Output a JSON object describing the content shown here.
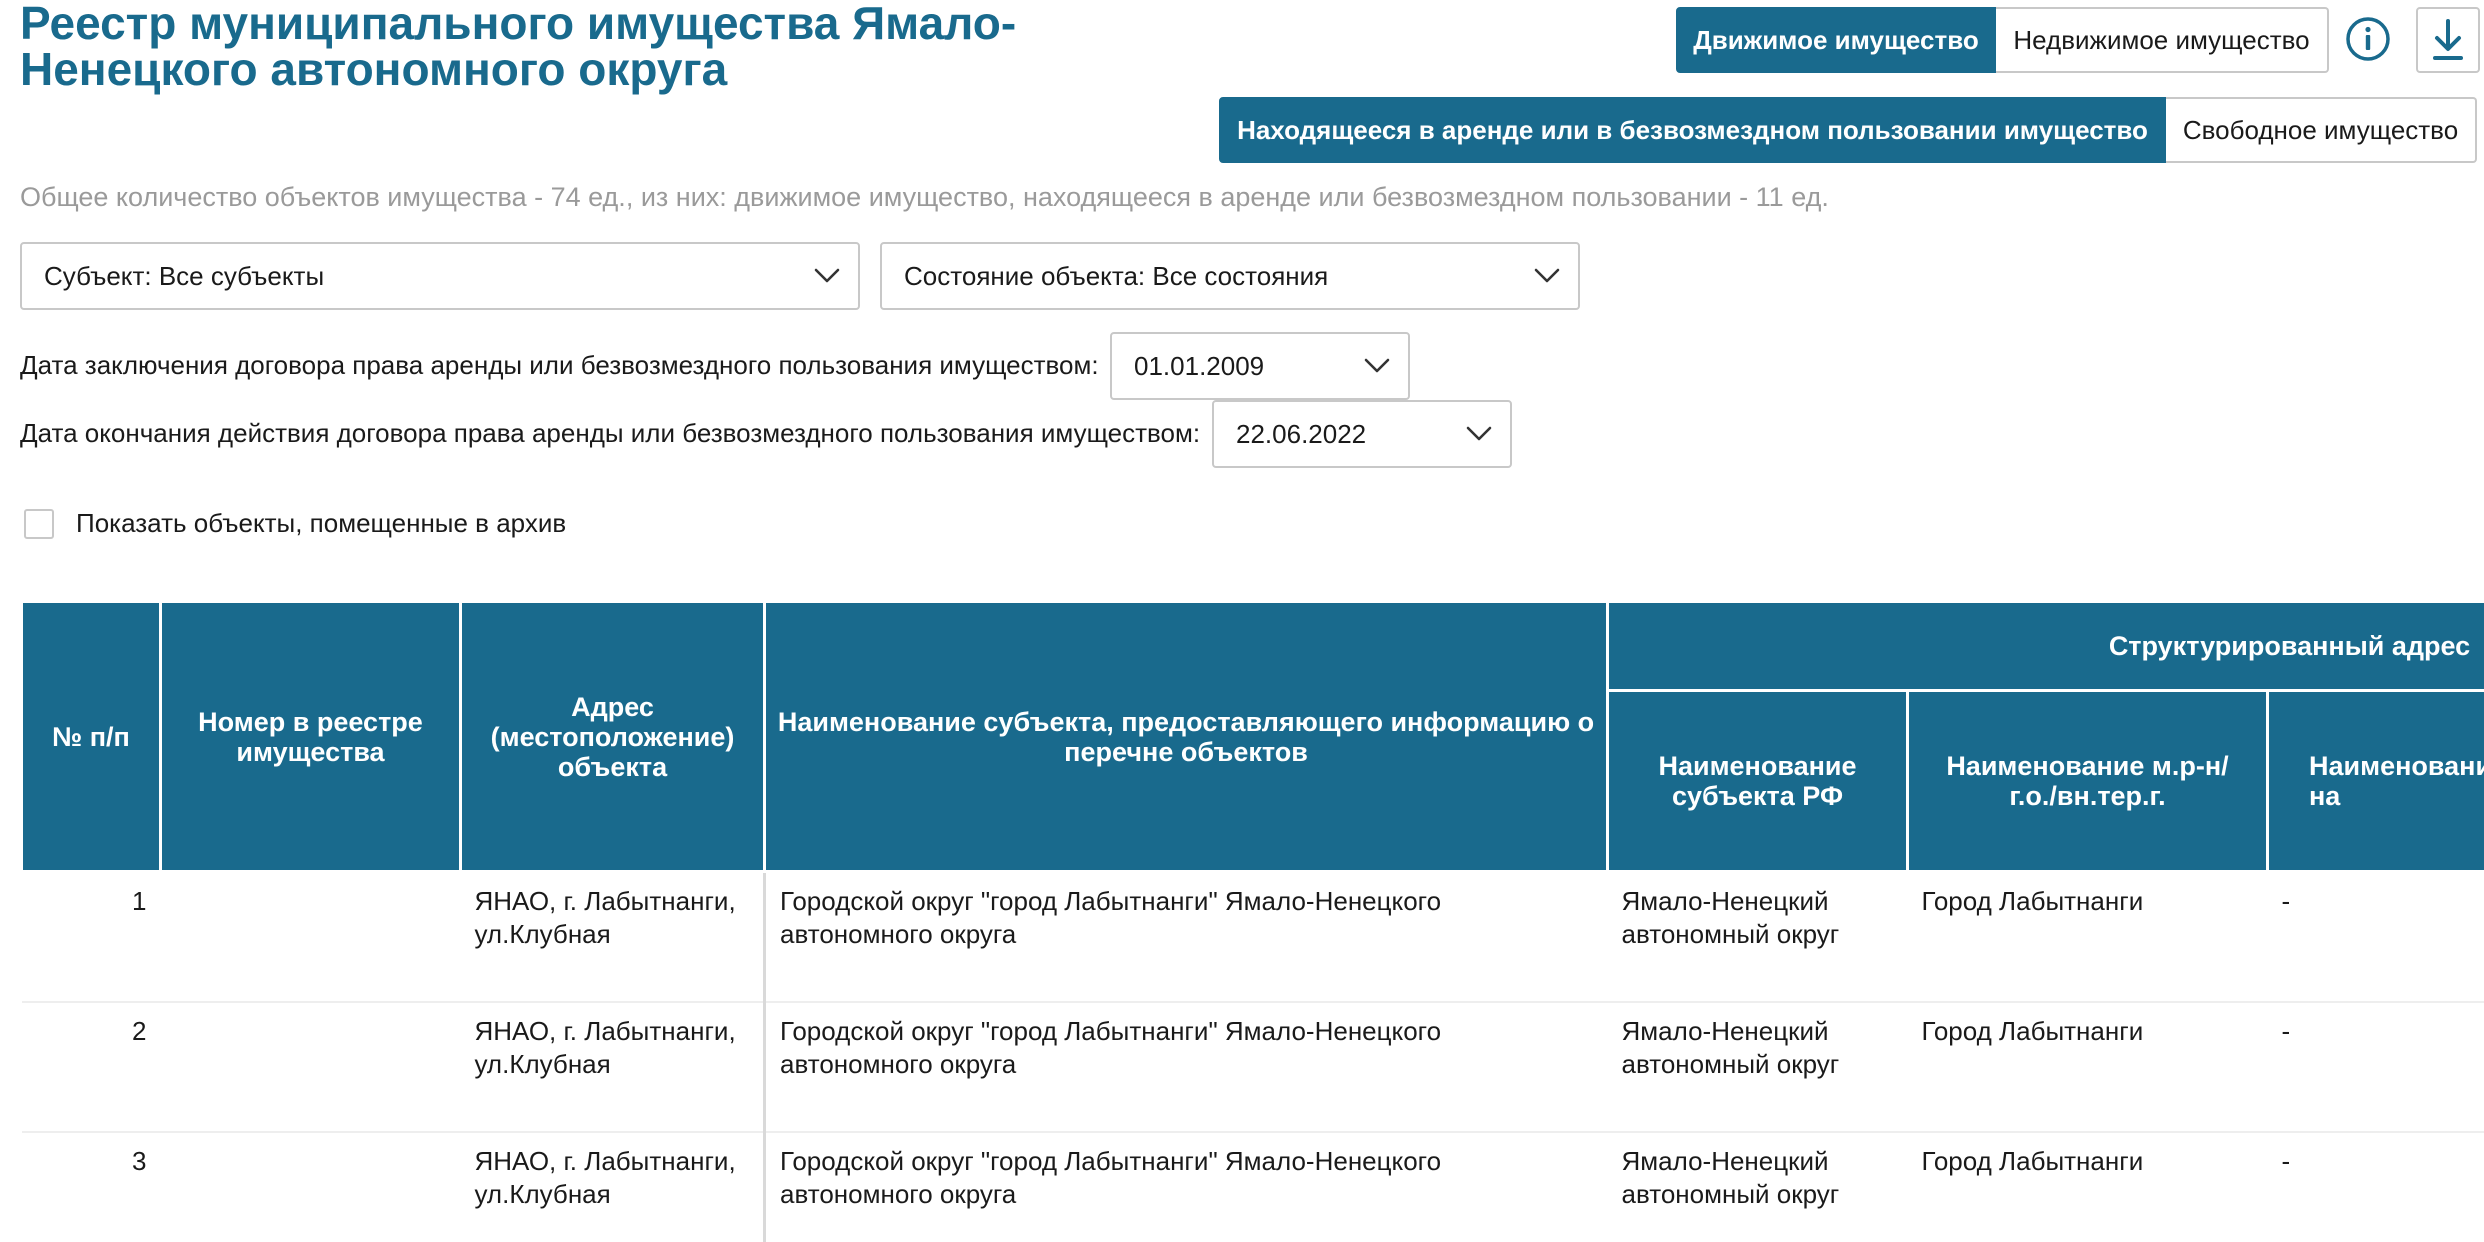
{
  "page": {
    "title": "Реестр муниципального имущества Ямало-Ненецкого автономного округа"
  },
  "property_type_toggle": {
    "options": [
      "Движимое имущество",
      "Недвижимое имущество"
    ],
    "active_index": 0
  },
  "status_toggle": {
    "options": [
      "Находящееся в аренде или в безвозмездном пользовании имущество",
      "Свободное имущество"
    ],
    "active_index": 0
  },
  "icons": {
    "info": "info-circle-icon",
    "download": "download-icon",
    "dropdown": "chevron-down-icon"
  },
  "summary": "Общее количество объектов имущества - 74 ед., из них: движимое имущество, находящееся в аренде или безвозмездном пользовании - 11 ед.",
  "filters": {
    "subject": "Субъект: Все субъекты",
    "state": "Состояние объекта: Все состояния",
    "contract_start_label": "Дата заключения договора права аренды или безвозмездного пользования имуществом:",
    "contract_start_value": "01.01.2009",
    "contract_end_label": "Дата окончания действия договора права аренды или безвозмездного пользования имуществом:",
    "contract_end_value": "22.06.2022",
    "archive_checkbox_label": "Показать объекты, помещенные в архив",
    "archive_checked": false
  },
  "table": {
    "headers": {
      "num": "№ п/п",
      "registry_number": "Номер в реестре имущества",
      "address": "Адрес (местоположение) объекта",
      "subject_name": "Наименование субъекта, предоставляющего информацию о перечне объектов",
      "structured_address": "Структурированный адрес",
      "rf_subject": "Наименование субъекта РФ",
      "municipal_district": "Наименование м.р-н/ г.о./вн.тер.г.",
      "settlement": "Наименование г.п./с.п./вн.р-на"
    },
    "rows": [
      {
        "num": "1",
        "registry_number": "",
        "address": "ЯНАО, г. Лабытнанги, ул.Клубная",
        "subject_name": "Городской округ \"город Лабытнанги\" Ямало-Ненецкого автономного округа",
        "rf_subject": "Ямало-Ненецкий автономный округ",
        "municipal_district": "Город Лабытнанги",
        "settlement": "-"
      },
      {
        "num": "2",
        "registry_number": "",
        "address": "ЯНАО, г. Лабытнанги, ул.Клубная",
        "subject_name": "Городской округ \"город Лабытнанги\" Ямало-Ненецкого автономного округа",
        "rf_subject": "Ямало-Ненецкий автономный округ",
        "municipal_district": "Город Лабытнанги",
        "settlement": "-"
      },
      {
        "num": "3",
        "registry_number": "",
        "address": "ЯНАО, г. Лабытнанги, ул.Клубная",
        "subject_name": "Городской округ \"город Лабытнанги\" Ямало-Ненецкого автономного округа",
        "rf_subject": "Ямало-Ненецкий автономный округ",
        "municipal_district": "Город Лабытнанги",
        "settlement": "-"
      }
    ]
  },
  "colors": {
    "accent": "#196a8d",
    "muted_text": "#9a9a9a",
    "border": "#c8c8c8"
  }
}
